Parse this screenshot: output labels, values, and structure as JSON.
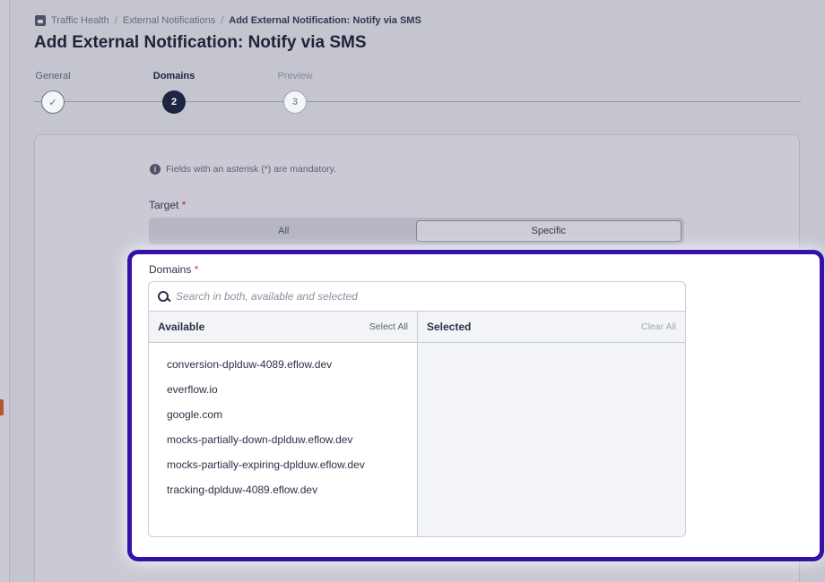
{
  "breadcrumb": {
    "items": [
      "Traffic Health",
      "External Notifications",
      "Add External Notification: Notify via SMS"
    ],
    "separator": "/"
  },
  "page_title": "Add External Notification: Notify via SMS",
  "stepper": {
    "steps": [
      {
        "label": "General",
        "marker": "✓",
        "state": "done"
      },
      {
        "label": "Domains",
        "marker": "2",
        "state": "current"
      },
      {
        "label": "Preview",
        "marker": "3",
        "state": "todo"
      }
    ]
  },
  "form": {
    "mandatory_hint": "Fields with an asterisk (*) are mandatory.",
    "required_mark": "*",
    "target": {
      "label": "Target",
      "options": [
        "All",
        "Specific"
      ],
      "selected": "Specific"
    },
    "domains": {
      "label": "Domains",
      "search_placeholder": "Search in both, available and selected",
      "search_value": "",
      "available": {
        "title": "Available",
        "action": "Select All",
        "items": [
          "conversion-dplduw-4089.eflow.dev",
          "everflow.io",
          "google.com",
          "mocks-partially-down-dplduw.eflow.dev",
          "mocks-partially-expiring-dplduw.eflow.dev",
          "tracking-dplduw-4089.eflow.dev"
        ]
      },
      "selected": {
        "title": "Selected",
        "action": "Clear All",
        "items": []
      }
    }
  },
  "colors": {
    "highlight_border": "#3412a8",
    "accent_required": "#d23a3a",
    "step_current": "#1d2540",
    "rail_tab": "#e2642c"
  },
  "icons": [
    "breadcrumb-app-icon",
    "check-icon",
    "info-icon",
    "search-icon"
  ]
}
